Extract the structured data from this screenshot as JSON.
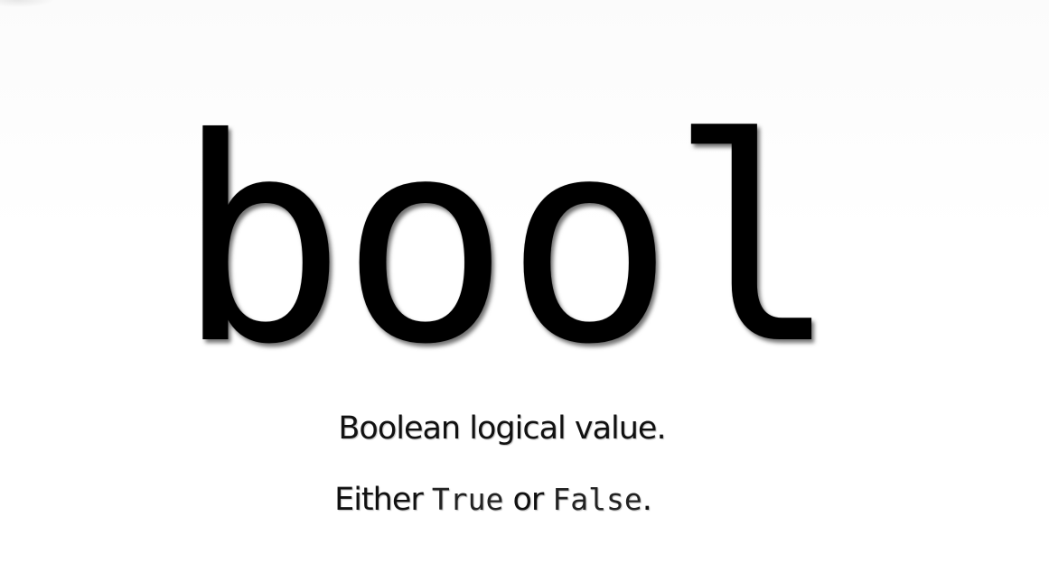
{
  "slide": {
    "title": "bool",
    "description": "Boolean logical value.",
    "values_line": {
      "prefix": "Either ",
      "true_literal": "True",
      "middle": " or ",
      "false_literal": "False",
      "suffix": "."
    }
  },
  "colors": {
    "background": "#ffffff",
    "text": "#000000"
  }
}
